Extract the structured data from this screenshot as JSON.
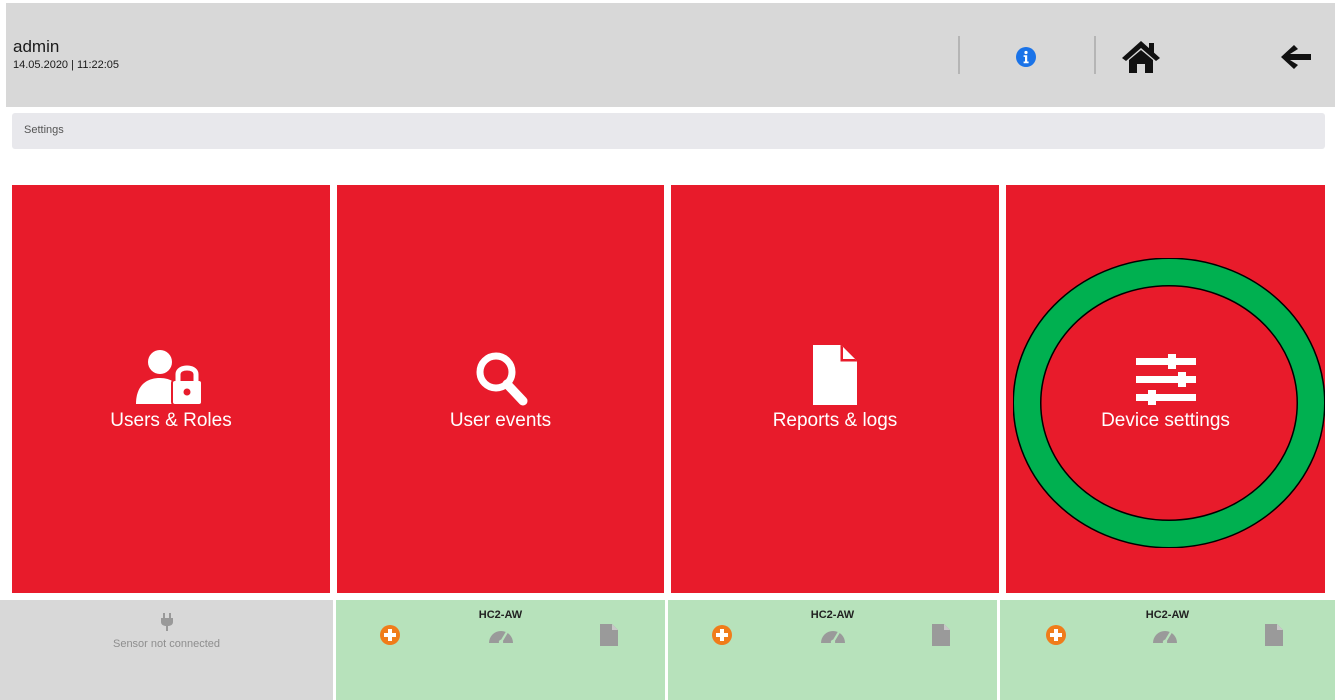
{
  "header": {
    "user": "admin",
    "datetime": "14.05.2020 | 11:22:05",
    "icons": [
      "info-icon",
      "home-icon",
      "back-arrow-icon"
    ],
    "info_color": "#1a73e8"
  },
  "breadcrumb": {
    "label": "Settings"
  },
  "tiles": [
    {
      "label": "Users & Roles",
      "icon": "user-lock-icon"
    },
    {
      "label": "User events",
      "icon": "search-icon"
    },
    {
      "label": "Reports & logs",
      "icon": "file-icon"
    },
    {
      "label": "Device settings",
      "icon": "sliders-icon",
      "highlighted": true
    }
  ],
  "tile_color": "#e81b2b",
  "highlight_color": "#00b050",
  "footer": {
    "sensor_status": "Sensor not connected",
    "sensors": [
      {
        "name": "HC2-AW"
      },
      {
        "name": "HC2-AW"
      },
      {
        "name": "HC2-AW"
      }
    ],
    "add_color": "#f07c1a",
    "connected_bg": "#b7e2bb"
  }
}
